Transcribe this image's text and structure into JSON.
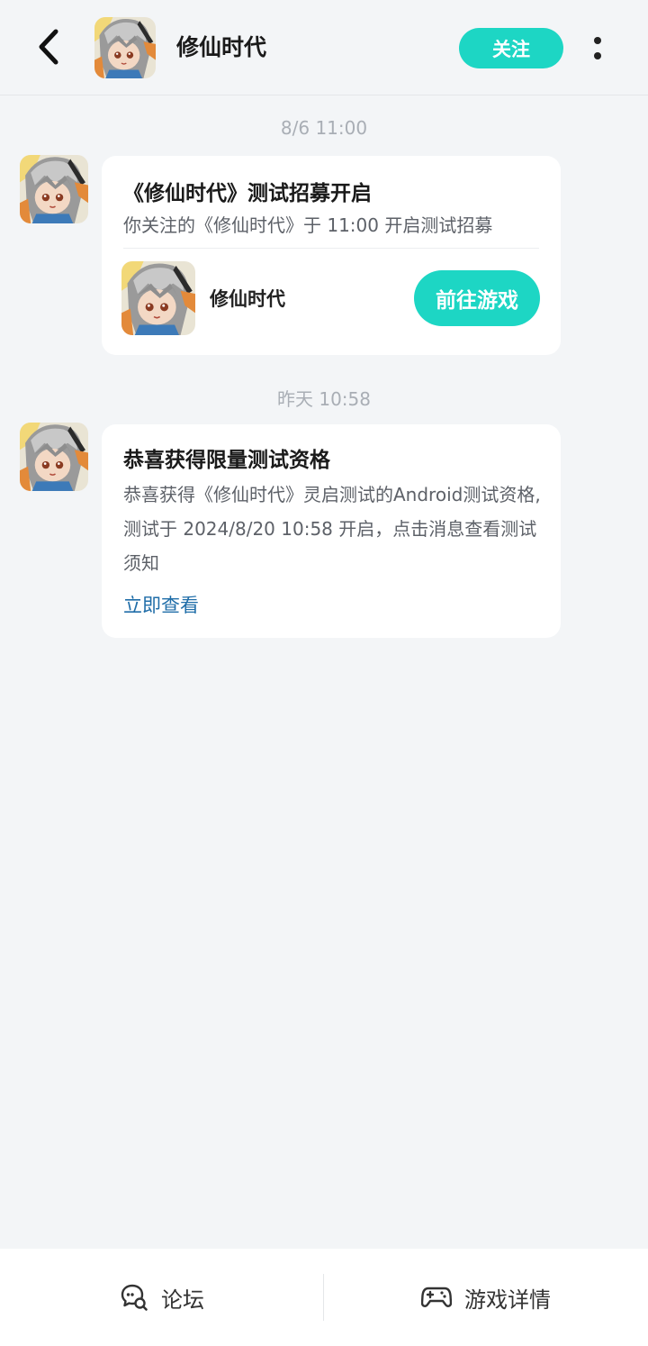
{
  "header": {
    "title": "修仙时代",
    "follow_label": "关注",
    "back_icon": "chevron-left-icon",
    "more_icon": "more-vertical-icon"
  },
  "messages": [
    {
      "time": "8/6  11:00",
      "title": "《修仙时代》测试招募开启",
      "subtitle": "你关注的《修仙时代》于 11:00 开启测试招募",
      "game_name": "修仙时代",
      "action_label": "前往游戏"
    },
    {
      "time": "昨天  10:58",
      "title": "恭喜获得限量测试资格",
      "body": "恭喜获得《修仙时代》灵启测试的Android测试资格,测试于 2024/8/20 10:58 开启，点击消息查看测试须知",
      "link_label": "立即查看"
    }
  ],
  "bottom_bar": {
    "forum_label": "论坛",
    "details_label": "游戏详情"
  },
  "colors": {
    "accent": "#1dd6c4",
    "link": "#1f6da8",
    "background": "#f3f5f7"
  }
}
